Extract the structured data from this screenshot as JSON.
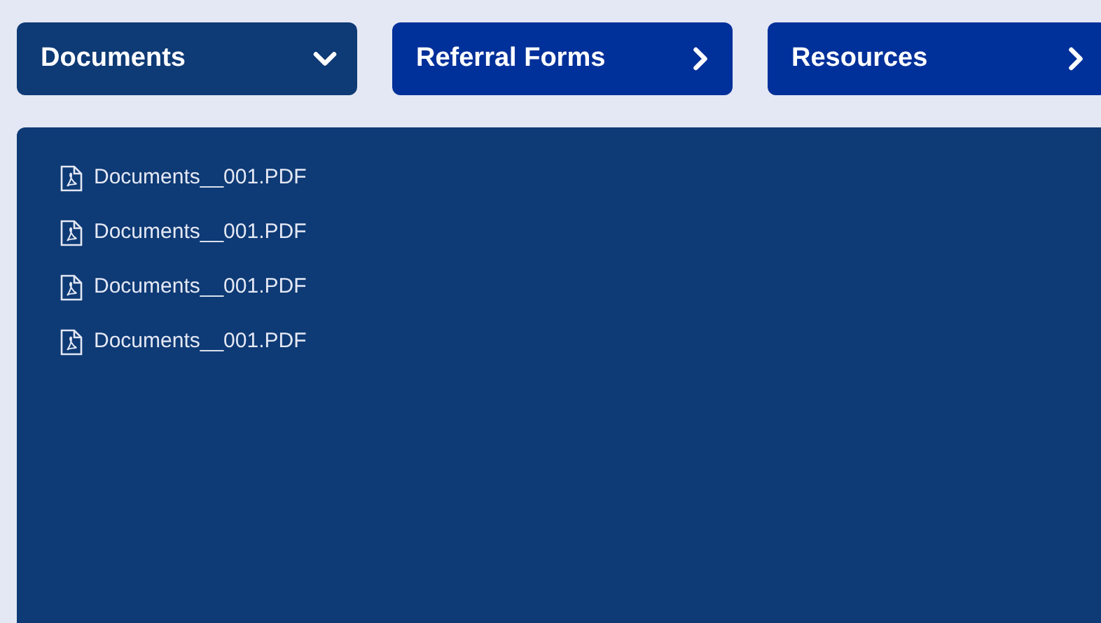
{
  "tabs": [
    {
      "label": "Documents",
      "expanded": true
    },
    {
      "label": "Referral Forms",
      "expanded": false
    },
    {
      "label": "Resources",
      "expanded": false
    }
  ],
  "files": [
    {
      "name": "Documents__001.PDF"
    },
    {
      "name": "Documents__001.PDF"
    },
    {
      "name": "Documents__001.PDF"
    },
    {
      "name": "Documents__001.PDF"
    }
  ]
}
